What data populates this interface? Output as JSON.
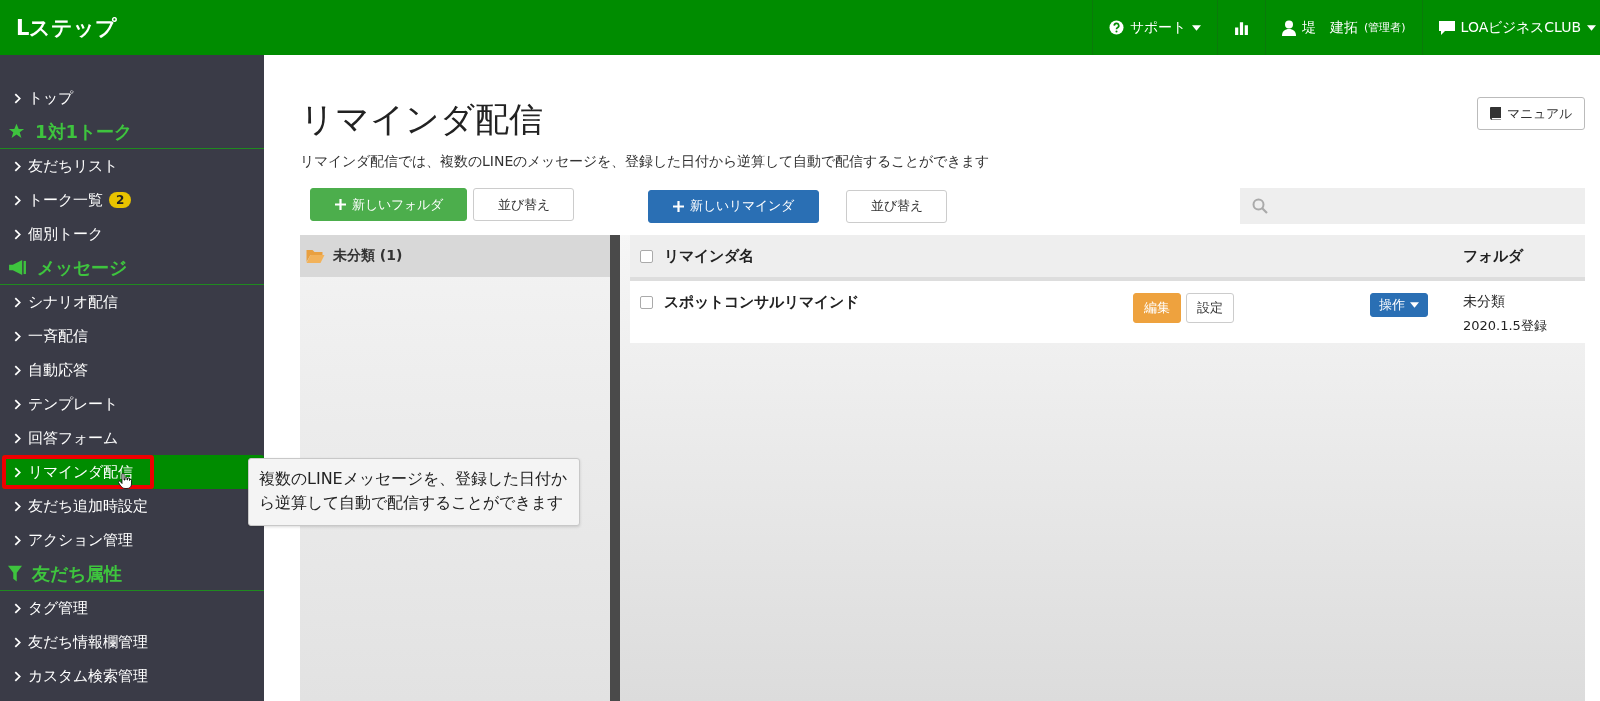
{
  "header": {
    "logo": "Lステップ",
    "menu": [
      {
        "kind": "support",
        "label": "サポート"
      },
      {
        "kind": "stats"
      },
      {
        "kind": "user",
        "label": "堤　建拓",
        "note": "(管理者)"
      },
      {
        "kind": "account",
        "label": "LOAビジネスCLUB"
      }
    ]
  },
  "sidebar": {
    "top": {
      "label": "トップ",
      "selected": false
    },
    "sections": [
      {
        "heading": "1対1トーク",
        "items": [
          {
            "label": "友だちリスト",
            "selected": false,
            "highlighted": false
          },
          {
            "label": "トーク一覧",
            "badge": "2",
            "selected": false,
            "highlighted": false
          },
          {
            "label": "個別トーク",
            "selected": false,
            "highlighted": false
          }
        ]
      },
      {
        "heading": "メッセージ",
        "items": [
          {
            "label": "シナリオ配信",
            "selected": false,
            "highlighted": false
          },
          {
            "label": "一斉配信",
            "selected": false,
            "highlighted": false
          },
          {
            "label": "自動応答",
            "selected": false,
            "highlighted": false
          },
          {
            "label": "テンプレート",
            "selected": false,
            "highlighted": false
          },
          {
            "label": "回答フォーム",
            "selected": false,
            "highlighted": false
          },
          {
            "label": "リマインダ配信",
            "selected": true,
            "highlighted": true
          },
          {
            "label": "友だち追加時設定",
            "selected": false,
            "highlighted": false
          },
          {
            "label": "アクション管理",
            "selected": false,
            "highlighted": false
          }
        ]
      },
      {
        "heading": "友だち属性",
        "items": [
          {
            "label": "タグ管理",
            "selected": false,
            "highlighted": false
          },
          {
            "label": "友だち情報欄管理",
            "selected": false,
            "highlighted": false
          },
          {
            "label": "カスタム検索管理",
            "selected": false,
            "highlighted": false
          }
        ]
      }
    ]
  },
  "tooltip": {
    "text": "複数のLINEメッセージを、登録した日付から逆算して自動で配信することができます"
  },
  "main": {
    "title": "リマインダ配信",
    "manual_button": "マニュアル",
    "description": "リマインダ配信では、複数のLINEのメッセージを、登録した日付から逆算して自動で配信することができます",
    "folder_toolbar": {
      "new_button": "新しいフォルダ",
      "sort_button": "並び替え"
    },
    "reminder_toolbar": {
      "new_button": "新しいリマインダ",
      "sort_button": "並び替え"
    },
    "folders": [
      {
        "label": "未分類 (1)",
        "selected": true
      }
    ],
    "table": {
      "columns": [
        "リマインダ名",
        "フォルダ"
      ],
      "all_checked": false,
      "rows": [
        {
          "name": "スポットコンサルリマインド",
          "checked": false,
          "edit": "編集",
          "settings": "設定",
          "action": "操作",
          "folder": "未分類",
          "registered": "2020.1.5登録"
        }
      ]
    }
  }
}
